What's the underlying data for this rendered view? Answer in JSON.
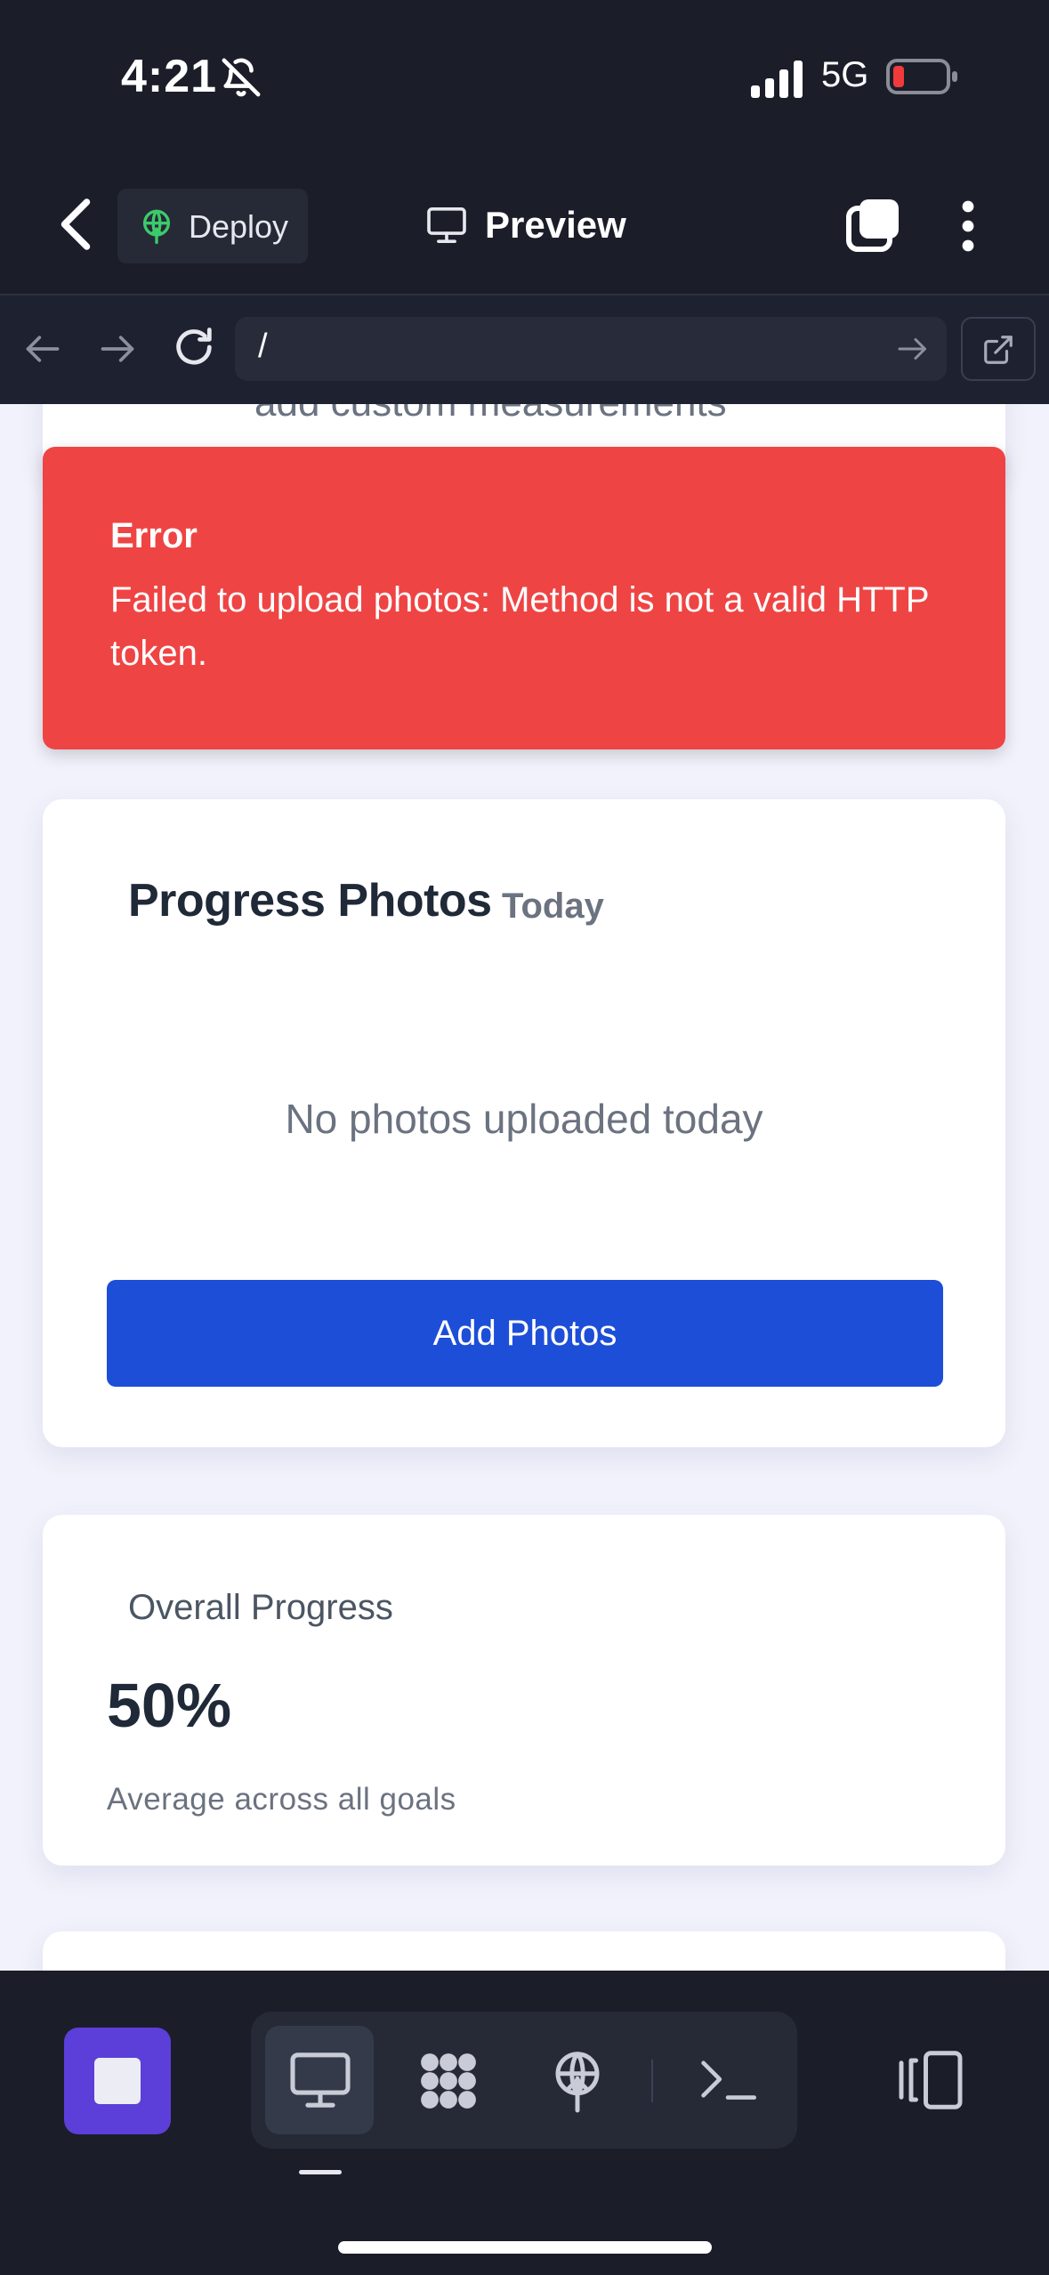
{
  "status_bar": {
    "time": "4:21",
    "network": "5G",
    "icons": [
      "bell-slash-icon",
      "signal-icon",
      "battery-low-icon"
    ]
  },
  "header": {
    "deploy_label": "Deploy",
    "preview_label": "Preview",
    "icons": [
      "chevron-left-icon",
      "deploy-icon",
      "monitor-icon",
      "tabs-icon",
      "more-vertical-icon"
    ]
  },
  "browser": {
    "url": "/",
    "icons": [
      "arrow-left-icon",
      "arrow-right-icon",
      "reload-icon",
      "go-arrow-icon",
      "external-link-icon"
    ]
  },
  "main": {
    "partial_text": "add custom measurements",
    "error": {
      "title": "Error",
      "message": "Failed to upload photos: Method is not a valid HTTP token."
    },
    "progress_photos": {
      "title": "Progress Photos",
      "subtitle": "Today",
      "empty_text": "No photos uploaded today",
      "add_button": "Add Photos"
    },
    "overall": {
      "label": "Overall Progress",
      "value": "50%",
      "caption": "Average across all goals"
    }
  },
  "bottom_bar": {
    "icons": [
      "stop-icon",
      "desktop-icon",
      "grid-icon",
      "deploy-icon",
      "terminal-icon",
      "layout-icon"
    ],
    "accent": "#5b3fd8"
  },
  "colors": {
    "error": "#ef4444",
    "primary_button": "#1d4ed8",
    "background": "#f2f2fc",
    "chrome": "#1b1d29"
  }
}
